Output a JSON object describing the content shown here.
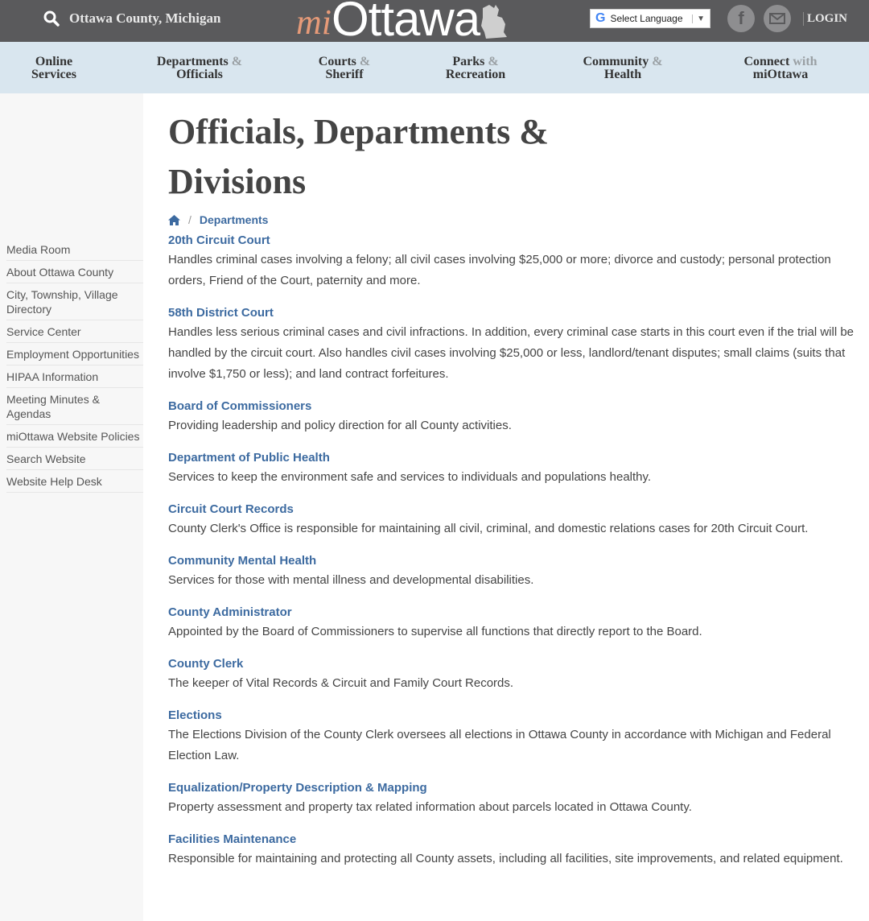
{
  "header": {
    "county": "Ottawa County, Michigan",
    "logo_mi": "mi",
    "logo_name": "Ottawa",
    "language_label": "Select Language",
    "login_label": "LOGIN",
    "social_fb": "f"
  },
  "nav": [
    {
      "line1a": "Online",
      "amp": "",
      "line2": "Services"
    },
    {
      "line1a": "Departments",
      "amp": "&",
      "line2": "Officials"
    },
    {
      "line1a": "Courts",
      "amp": "&",
      "line2": "Sheriff"
    },
    {
      "line1a": "Parks",
      "amp": "&",
      "line2": "Recreation"
    },
    {
      "line1a": "Community",
      "amp": "&",
      "line2": "Health"
    },
    {
      "line1a": "Connect",
      "amp": "with",
      "line2": "miOttawa"
    }
  ],
  "sidebar": {
    "items": [
      "Media Room",
      "About Ottawa County",
      "City, Township, Village Directory",
      "Service Center",
      "Employment Opportunities",
      "HIPAA Information",
      "Meeting Minutes & Agendas",
      "miOttawa Website Policies",
      "Search Website",
      "Website Help Desk"
    ]
  },
  "page": {
    "title": "Officials, Departments & Divisions",
    "breadcrumb_current": "Departments"
  },
  "departments": [
    {
      "title": "20th Circuit Court",
      "desc": "Handles criminal cases involving a felony; all civil cases involving $25,000 or more; divorce and custody; personal protection orders, Friend of the Court, paternity and more."
    },
    {
      "title": "58th District Court",
      "desc": "Handles less serious criminal cases and civil infractions. In addition, every criminal case starts in this court even if the trial will be handled by the circuit court.  Also handles civil cases involving $25,000 or less, landlord/tenant disputes; small claims (suits that involve $1,750 or less); and land contract forfeitures."
    },
    {
      "title": "Board of Commissioners",
      "desc": "Providing leadership and policy direction for all County activities."
    },
    {
      "title": "Department of Public Health",
      "desc": "Services to keep the environment safe and services to individuals and populations healthy."
    },
    {
      "title": "Circuit Court Records",
      "desc": "County Clerk's Office is responsible for maintaining all civil, criminal, and domestic relations cases for 20th Circuit Court."
    },
    {
      "title": "Community Mental Health",
      "desc": "Services for those with mental illness and developmental disabilities."
    },
    {
      "title": "County Administrator",
      "desc": "Appointed by the Board of Commissioners to supervise all functions that directly report to the Board."
    },
    {
      "title": "County Clerk",
      "desc": "The keeper of Vital Records & Circuit and Family Court Records."
    },
    {
      "title": "Elections",
      "desc": "The Elections Division of the County Clerk oversees all elections in Ottawa County in accordance with Michigan and Federal Election Law."
    },
    {
      "title": "Equalization/Property Description & Mapping",
      "desc": "Property assessment and property tax related information about parcels located in Ottawa County."
    },
    {
      "title": "Facilities Maintenance",
      "desc": "Responsible for maintaining and protecting all County assets, including all facilities, site improvements, and related equipment."
    }
  ]
}
